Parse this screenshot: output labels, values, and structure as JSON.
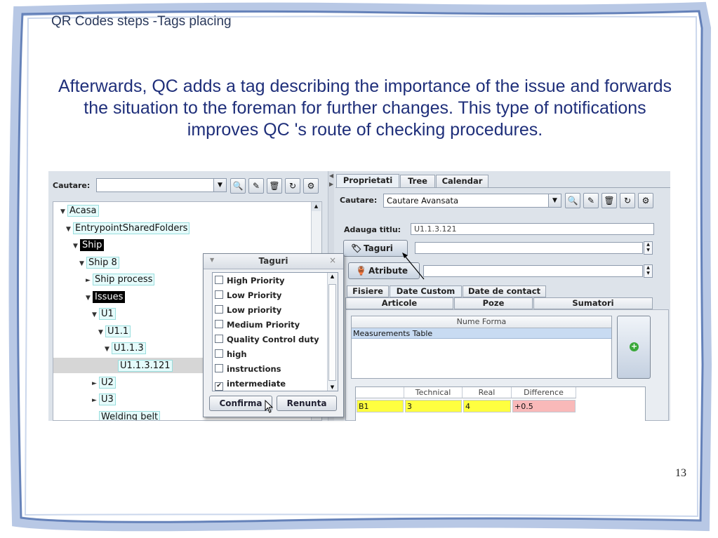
{
  "slide": {
    "title": "QR Codes steps -Tags placing",
    "body": "Afterwards, QC adds a tag describing the importance of the issue and forwards the situation to the foreman for further changes. This type of notifications improves QC 's route of checking procedures.",
    "page_number": "13"
  },
  "left_panel": {
    "search_label": "Cautare:",
    "search_value": "",
    "tree": [
      {
        "label": "Acasa",
        "toggle": "▼",
        "style": "cyan"
      },
      {
        "label": "EntrypointSharedFolders",
        "toggle": "▼",
        "style": "cyan"
      },
      {
        "label": "Ship",
        "toggle": "▼",
        "style": "dark"
      },
      {
        "label": "Ship 8",
        "toggle": "▼",
        "style": "cyan"
      },
      {
        "label": "Ship process",
        "toggle": "►",
        "style": "cyan"
      },
      {
        "label": "Issues",
        "toggle": "▼",
        "style": "dark"
      },
      {
        "label": "U1",
        "toggle": "▼",
        "style": "cyan"
      },
      {
        "label": "U1.1",
        "toggle": "▼",
        "style": "cyan"
      },
      {
        "label": "U1.1.3",
        "toggle": "▼",
        "style": "cyan"
      },
      {
        "label": "U1.1.3.121",
        "toggle": "",
        "style": "cyan"
      },
      {
        "label": "U2",
        "toggle": "►",
        "style": "cyan"
      },
      {
        "label": "U3",
        "toggle": "►",
        "style": "cyan"
      },
      {
        "label": "Welding belt",
        "toggle": "",
        "style": "cyan"
      }
    ]
  },
  "dialog": {
    "title": "Taguri",
    "options": [
      {
        "label": "High Priority",
        "checked": false
      },
      {
        "label": "Low Priority",
        "checked": false
      },
      {
        "label": "Low priority",
        "checked": false
      },
      {
        "label": "Medium Priority",
        "checked": false
      },
      {
        "label": "Quality Control duty",
        "checked": false
      },
      {
        "label": "high",
        "checked": false
      },
      {
        "label": "instructions",
        "checked": false
      },
      {
        "label": "intermediate",
        "checked": true
      }
    ],
    "confirm_label": "Confirma",
    "cancel_label": "Renunta"
  },
  "right_panel": {
    "tabs": [
      "Proprietati",
      "Tree",
      "Calendar"
    ],
    "active_tab": "Proprietati",
    "search_label": "Cautare:",
    "search_value": "Cautare Avansata",
    "title_label": "Adauga titlu:",
    "title_value": "U1.1.3.121",
    "tags_button": "Taguri",
    "attributes_button": "Atribute",
    "sub_tabs_row1": [
      "Fisiere",
      "Date Custom",
      "Date de contact"
    ],
    "sub_tabs_row2": [
      "Articole",
      "Poze",
      "Sumatori"
    ],
    "active_sub_tab": "Date Custom",
    "forms_table": {
      "header": "Nume Forma",
      "rows": [
        "Measurements Table"
      ]
    },
    "measurements": {
      "headers": [
        "",
        "Technical",
        "Real",
        "Difference"
      ],
      "rows": [
        [
          "B1",
          "3",
          "4",
          "+0.5"
        ]
      ]
    }
  }
}
